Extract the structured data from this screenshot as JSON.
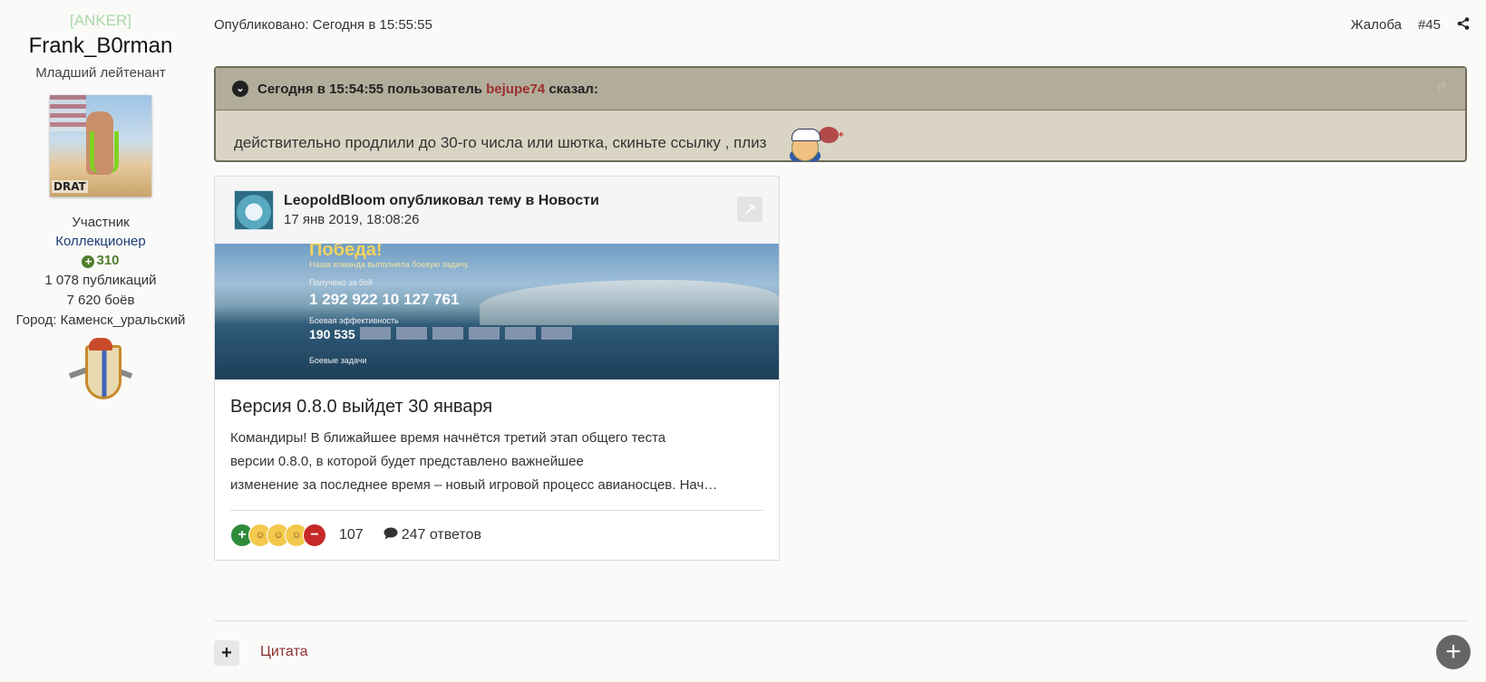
{
  "author": {
    "clan": "[ANKER]",
    "username": "Frank_B0rman",
    "rank": "Младший лейтенант",
    "avatar_logo": "DRAT",
    "group": "Участник",
    "title": "Коллекционер",
    "reputation": "310",
    "posts": "1 078 публикаций",
    "battles": "7 620 боёв",
    "city": "Город: Каменск_уральский"
  },
  "post": {
    "posted": "Опубликовано: Сегодня в 15:55:55",
    "report": "Жалоба",
    "number": "#45"
  },
  "quote": {
    "prefix": "Сегодня в 15:54:55 пользователь",
    "user": "bejupe74",
    "suffix": "сказал:",
    "text": "действительно продлили до 30-го числа или шютка, скиньте ссылку , плиз"
  },
  "embed": {
    "author_line": "LeopoldBloom опубликовал тему в Новости",
    "date": "17 янв 2019, 18:08:26",
    "image": {
      "heading": "Победа!",
      "subtitle": "Наша команда выполнила боевую задачу.",
      "earned_label": "Получено за бой",
      "earned": "1 292 922   10 127   761",
      "efficiency_label": "Боевая эффективность",
      "efficiency": "190 535",
      "tasks_label": "Боевые задачи"
    },
    "title": "Версия 0.8.0 выйдет 30 января",
    "lines": [
      "Командиры!   В ближайшее время начнётся третий этап общего теста",
      "версии 0.8.0, в которой будет представлено важнейшее",
      "изменение за последнее время – новый игровой процесс авианосцев. Нач…"
    ],
    "reactions_count": "107",
    "comments": "247 ответов"
  },
  "footer": {
    "quote_label": "Цитата"
  }
}
